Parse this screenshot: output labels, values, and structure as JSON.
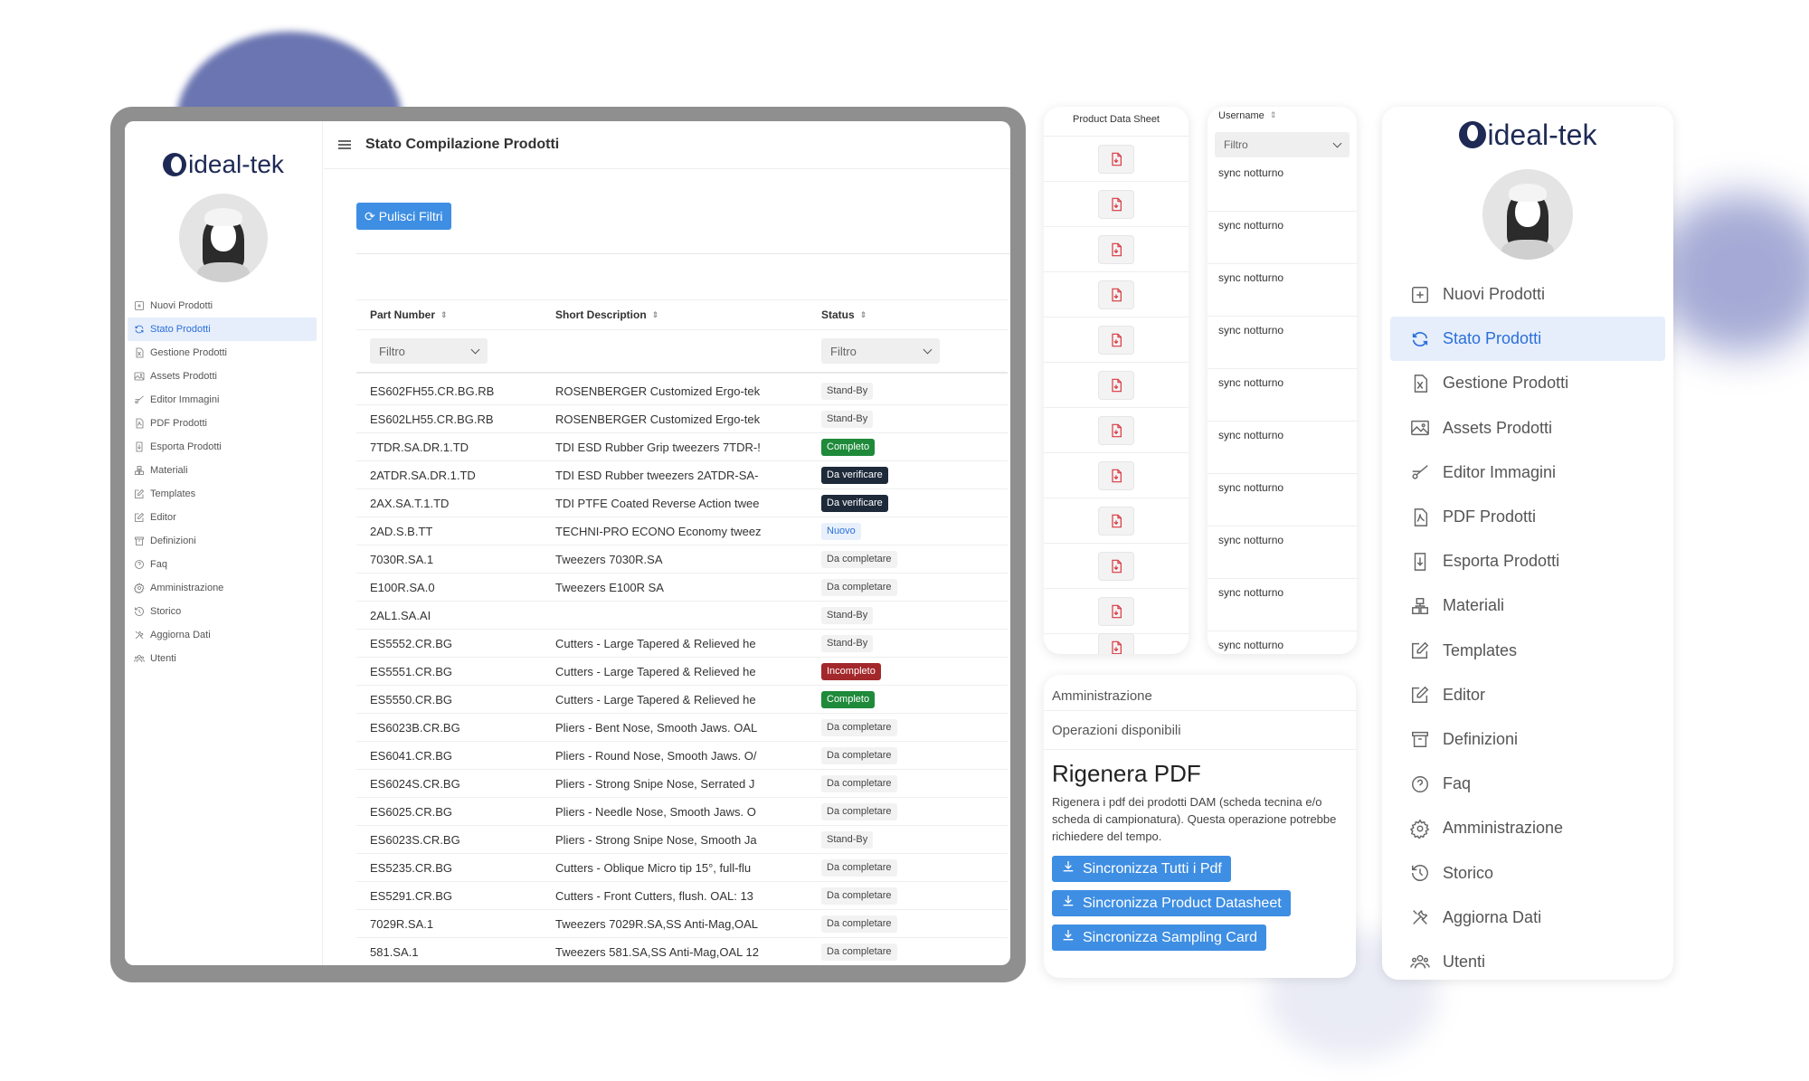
{
  "app": {
    "logo_text": "ideal-tek",
    "page_title": "Stato Compilazione Prodotti",
    "accent_color": "#2a6fdb"
  },
  "sidebar": {
    "items": [
      {
        "label": "Nuovi Prodotti",
        "icon": "plus-square-icon",
        "active": false
      },
      {
        "label": "Stato Prodotti",
        "icon": "sync-icon",
        "active": true
      },
      {
        "label": "Gestione Prodotti",
        "icon": "file-excel-icon",
        "active": false
      },
      {
        "label": "Assets Prodotti",
        "icon": "image-icon",
        "active": false
      },
      {
        "label": "Editor Immagini",
        "icon": "scissors-icon",
        "active": false
      },
      {
        "label": "PDF Prodotti",
        "icon": "pdf-file-icon",
        "active": false
      },
      {
        "label": "Esporta Prodotti",
        "icon": "export-file-icon",
        "active": false
      },
      {
        "label": "Materiali",
        "icon": "boxes-icon",
        "active": false
      },
      {
        "label": "Templates",
        "icon": "edit-icon",
        "active": false
      },
      {
        "label": "Editor",
        "icon": "edit-icon",
        "active": false
      },
      {
        "label": "Definizioni",
        "icon": "archive-icon",
        "active": false
      },
      {
        "label": "Faq",
        "icon": "question-icon",
        "active": false
      },
      {
        "label": "Amministrazione",
        "icon": "gear-icon",
        "active": false
      },
      {
        "label": "Storico",
        "icon": "history-icon",
        "active": false
      },
      {
        "label": "Aggiorna Dati",
        "icon": "tools-icon",
        "active": false
      },
      {
        "label": "Utenti",
        "icon": "users-icon",
        "active": false
      }
    ]
  },
  "toolbar": {
    "clear_filters_label": "Pulisci Filtri"
  },
  "table": {
    "headers": {
      "part_number": "Part Number",
      "short_description": "Short Description",
      "status": "Status"
    },
    "filter_placeholder": "Filtro",
    "rows": [
      {
        "part": "ES602FH55.CR.BG.RB",
        "desc": "ROSENBERGER Customized Ergo-tek",
        "status": "Stand-By",
        "kind": "standby"
      },
      {
        "part": "ES602LH55.CR.BG.RB",
        "desc": "ROSENBERGER Customized Ergo-tek",
        "status": "Stand-By",
        "kind": "standby"
      },
      {
        "part": "7TDR.SA.DR.1.TD",
        "desc": "TDI ESD Rubber Grip tweezers 7TDR-!",
        "status": "Completo",
        "kind": "completo"
      },
      {
        "part": "2ATDR.SA.DR.1.TD",
        "desc": "TDI ESD Rubber tweezers 2ATDR-SA-",
        "status": "Da verificare",
        "kind": "verif"
      },
      {
        "part": "2AX.SA.T.1.TD",
        "desc": "TDI PTFE Coated Reverse Action twee",
        "status": "Da verificare",
        "kind": "verif"
      },
      {
        "part": "2AD.S.B.TT",
        "desc": "TECHNI-PRO ECONO Economy tweez",
        "status": "Nuovo",
        "kind": "nuovo"
      },
      {
        "part": "7030R.SA.1",
        "desc": "Tweezers 7030R.SA",
        "status": "Da completare",
        "kind": "dacompl"
      },
      {
        "part": "E100R.SA.0",
        "desc": "Tweezers E100R SA",
        "status": "Da completare",
        "kind": "dacompl"
      },
      {
        "part": "2AL1.SA.AI",
        "desc": "",
        "status": "Stand-By",
        "kind": "standby"
      },
      {
        "part": "ES5552.CR.BG",
        "desc": "Cutters - Large Tapered & Relieved he",
        "status": "Stand-By",
        "kind": "standby"
      },
      {
        "part": "ES5551.CR.BG",
        "desc": "Cutters - Large Tapered & Relieved he",
        "status": "Incompleto",
        "kind": "incompl"
      },
      {
        "part": "ES5550.CR.BG",
        "desc": "Cutters - Large Tapered & Relieved he",
        "status": "Completo",
        "kind": "completo"
      },
      {
        "part": "ES6023B.CR.BG",
        "desc": "Pliers - Bent Nose, Smooth Jaws. OAL",
        "status": "Da completare",
        "kind": "dacompl"
      },
      {
        "part": "ES6041.CR.BG",
        "desc": "Pliers - Round Nose, Smooth Jaws. O/",
        "status": "Da completare",
        "kind": "dacompl"
      },
      {
        "part": "ES6024S.CR.BG",
        "desc": "Pliers - Strong Snipe Nose, Serrated J",
        "status": "Da completare",
        "kind": "dacompl"
      },
      {
        "part": "ES6025.CR.BG",
        "desc": "Pliers - Needle Nose, Smooth Jaws. O",
        "status": "Da completare",
        "kind": "dacompl"
      },
      {
        "part": "ES6023S.CR.BG",
        "desc": "Pliers - Strong Snipe Nose, Smooth Ja",
        "status": "Stand-By",
        "kind": "standby"
      },
      {
        "part": "ES5235.CR.BG",
        "desc": "Cutters - Oblique Micro tip 15°, full-flu",
        "status": "Da completare",
        "kind": "dacompl"
      },
      {
        "part": "ES5291.CR.BG",
        "desc": "Cutters - Front Cutters, flush. OAL: 13",
        "status": "Da completare",
        "kind": "dacompl"
      },
      {
        "part": "7029R.SA.1",
        "desc": "Tweezers 7029R.SA,SS Anti-Mag,OAL",
        "status": "Da completare",
        "kind": "dacompl"
      },
      {
        "part": "581.SA.1",
        "desc": "Tweezers 581.SA,SS Anti-Mag,OAL 12",
        "status": "Da completare",
        "kind": "dacompl"
      }
    ]
  },
  "pds_card": {
    "header": "Product Data Sheet",
    "icon": "pdf-file-icon",
    "count": 12
  },
  "user_card": {
    "header": "Username",
    "filter_placeholder": "Filtro",
    "rows": [
      "sync notturno",
      "sync notturno",
      "sync notturno",
      "sync notturno",
      "sync notturno",
      "sync notturno",
      "sync notturno",
      "sync notturno",
      "sync notturno",
      "sync notturno"
    ]
  },
  "admin_card": {
    "header": "Amministrazione",
    "subheader": "Operazioni disponibili",
    "title": "Rigenera PDF",
    "description": "Rigenera i pdf dei prodotti DAM (scheda tecnina e/o scheda di campionatura). Questa operazione potrebbe richiedere del tempo.",
    "buttons": [
      "Sincronizza Tutti i Pdf",
      "Sincronizza Product Datasheet",
      "Sincronizza Sampling Card"
    ]
  }
}
